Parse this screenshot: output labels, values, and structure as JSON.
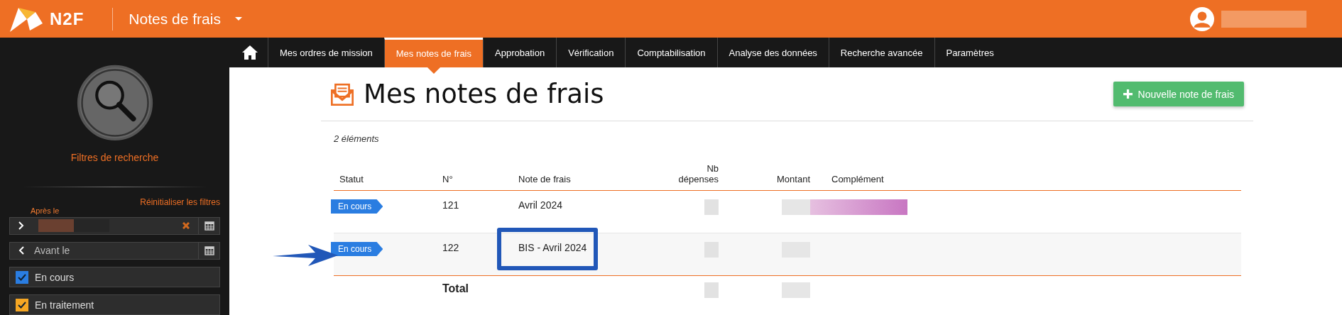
{
  "header": {
    "logo_text": "N2F",
    "app_title": "Notes de frais"
  },
  "nav": {
    "tabs": [
      {
        "label": "Mes ordres de mission",
        "selected": false
      },
      {
        "label": "Mes notes de frais",
        "selected": true
      },
      {
        "label": "Approbation",
        "selected": false
      },
      {
        "label": "Vérification",
        "selected": false
      },
      {
        "label": "Comptabilisation",
        "selected": false
      },
      {
        "label": "Analyse des données",
        "selected": false
      },
      {
        "label": "Recherche avancée",
        "selected": false
      },
      {
        "label": "Paramètres",
        "selected": false
      }
    ]
  },
  "sidebar": {
    "title": "Filtres de recherche",
    "reset_link": "Réinitialiser les filtres",
    "date_fields": [
      {
        "kind": "filled",
        "label": "Après le"
      },
      {
        "kind": "empty",
        "placeholder": "Avant le"
      }
    ],
    "status_filters": [
      {
        "label": "En cours",
        "checked": true,
        "color": "#2a7de1"
      },
      {
        "label": "En traitement",
        "checked": true,
        "color": "#f5a623"
      }
    ]
  },
  "page": {
    "title": "Mes notes de frais",
    "new_button": "Nouvelle note de frais",
    "count": "2 éléments"
  },
  "table": {
    "columns": [
      "Statut",
      "N°",
      "Note de frais",
      "Nb dépenses",
      "Montant",
      "Complément"
    ],
    "rows": [
      {
        "status": "En cours",
        "number": "121",
        "name": "Avril 2024",
        "highlighted": false
      },
      {
        "status": "En cours",
        "number": "122",
        "name": "BIS - Avril 2024",
        "highlighted": true
      }
    ],
    "total_label": "Total"
  }
}
